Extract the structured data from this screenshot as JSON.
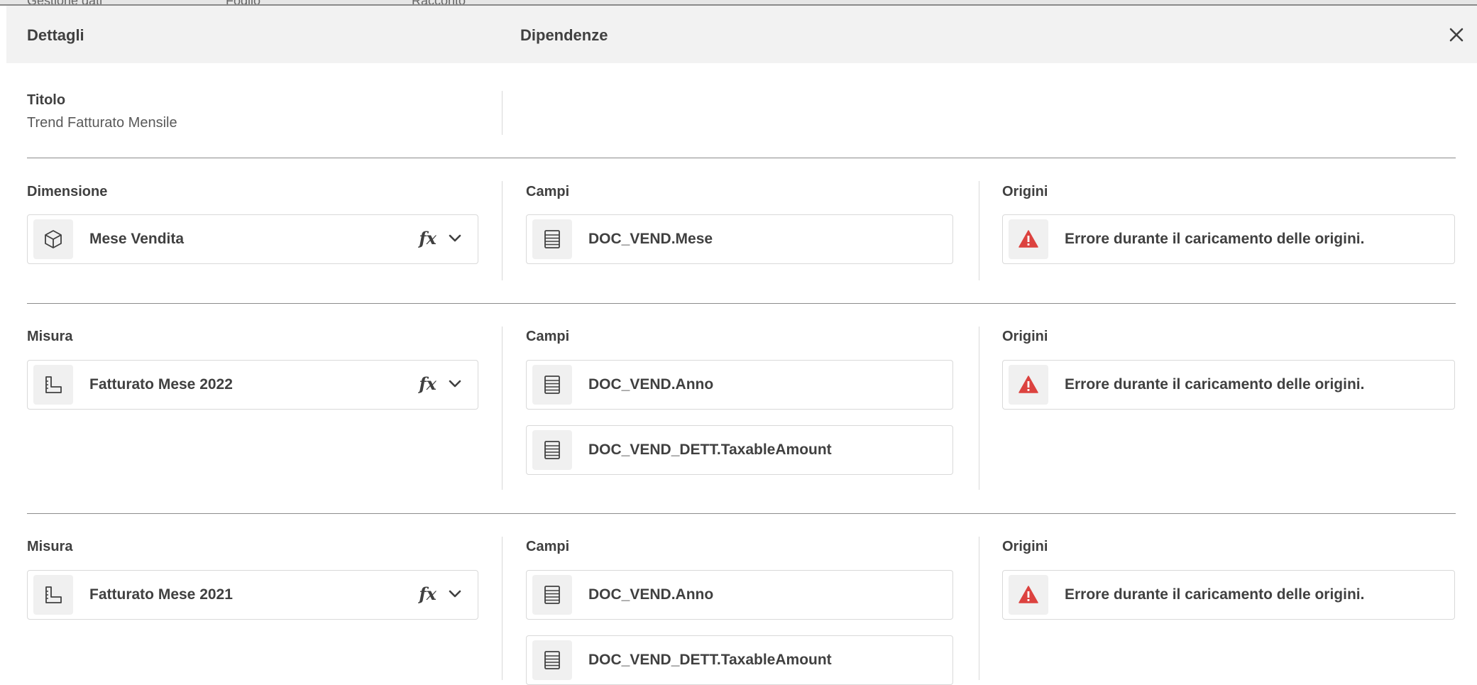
{
  "background_tabs": [
    "Gestione dati",
    "Foglio",
    "Racconto"
  ],
  "header": {
    "details_title": "Dettagli",
    "dependencies_title": "Dipendenze",
    "close_icon": "close-icon"
  },
  "title_block": {
    "label": "Titolo",
    "value": "Trend Fatturato Mensile"
  },
  "sections": [
    {
      "type_label": "Dimensione",
      "item": {
        "icon": "cube-icon",
        "label": "Mese Vendita"
      },
      "fields_label": "Campi",
      "fields": [
        "DOC_VEND.Mese"
      ],
      "sources_label": "Origini",
      "source_error": "Errore durante il caricamento delle origini."
    },
    {
      "type_label": "Misura",
      "item": {
        "icon": "measure-icon",
        "label": "Fatturato Mese 2022"
      },
      "fields_label": "Campi",
      "fields": [
        "DOC_VEND.Anno",
        "DOC_VEND_DETT.TaxableAmount"
      ],
      "sources_label": "Origini",
      "source_error": "Errore durante il caricamento delle origini."
    },
    {
      "type_label": "Misura",
      "item": {
        "icon": "measure-icon",
        "label": "Fatturato Mese 2021"
      },
      "fields_label": "Campi",
      "fields": [
        "DOC_VEND.Anno",
        "DOC_VEND_DETT.TaxableAmount"
      ],
      "sources_label": "Origini",
      "source_error": "Errore durante il caricamento delle origini."
    }
  ],
  "expression_symbol": "fx",
  "colors": {
    "header_bg": "#f2f2f2",
    "divider": "#8c8c8c",
    "error_red": "#dc423f",
    "text": "#404040"
  }
}
